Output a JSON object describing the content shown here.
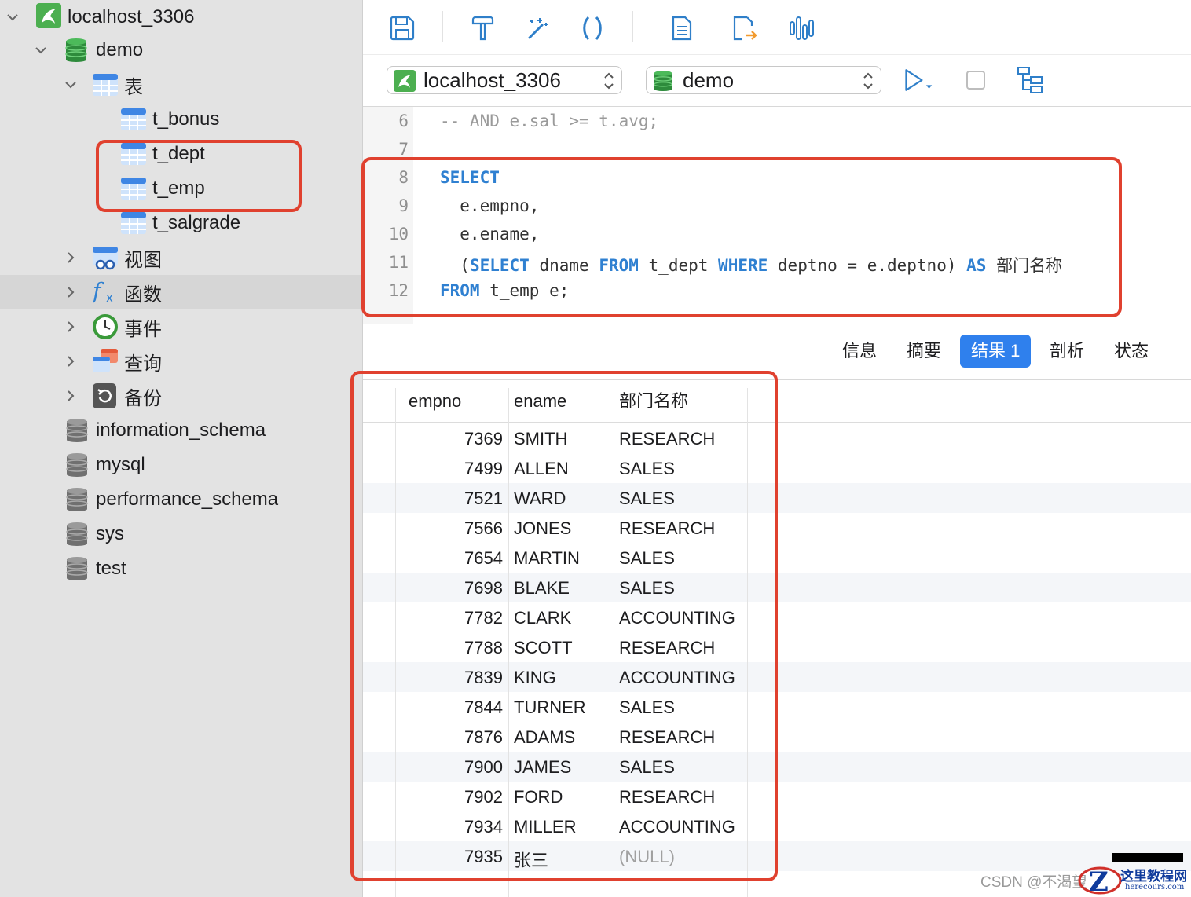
{
  "sidebar": {
    "items": [
      {
        "label": "localhost_3306",
        "icon": "mysql-connection-icon",
        "expanded": true
      },
      {
        "label": "demo",
        "icon": "database-icon",
        "expanded": true
      },
      {
        "label": "表",
        "icon": "tables-folder-icon",
        "expanded": true
      },
      {
        "label": "t_bonus",
        "icon": "table-icon"
      },
      {
        "label": "t_dept",
        "icon": "table-icon"
      },
      {
        "label": "t_emp",
        "icon": "table-icon"
      },
      {
        "label": "t_salgrade",
        "icon": "table-icon"
      },
      {
        "label": "视图",
        "icon": "views-folder-icon",
        "expanded": false
      },
      {
        "label": "函数",
        "icon": "function-icon",
        "expanded": false,
        "selected": true
      },
      {
        "label": "事件",
        "icon": "event-clock-icon",
        "expanded": false
      },
      {
        "label": "查询",
        "icon": "query-icon",
        "expanded": false
      },
      {
        "label": "备份",
        "icon": "backup-icon",
        "expanded": false
      },
      {
        "label": "information_schema",
        "icon": "database-grey-icon"
      },
      {
        "label": "mysql",
        "icon": "database-grey-icon"
      },
      {
        "label": "performance_schema",
        "icon": "database-grey-icon"
      },
      {
        "label": "sys",
        "icon": "database-grey-icon"
      },
      {
        "label": "test",
        "icon": "database-grey-icon"
      }
    ]
  },
  "toolbar": {
    "buttons": [
      "save-icon",
      "format-hammer-icon",
      "magic-wand-icon",
      "parentheses-icon",
      "document-icon",
      "export-icon",
      "explain-chart-icon"
    ]
  },
  "selectors": {
    "connection": "localhost_3306",
    "database": "demo"
  },
  "editor": {
    "lines": [
      {
        "no": "6",
        "text": "-- AND e.sal >= t.avg;"
      },
      {
        "no": "7",
        "text": ""
      },
      {
        "no": "8",
        "text": "SELECT"
      },
      {
        "no": "9",
        "text": "  e.empno,"
      },
      {
        "no": "10",
        "text": "  e.ename,"
      },
      {
        "no": "11",
        "text": "  (SELECT dname FROM t_dept WHERE deptno = e.deptno) AS 部门名称"
      },
      {
        "no": "12",
        "text": "FROM t_emp e;"
      }
    ]
  },
  "result_tabs": [
    "信息",
    "摘要",
    "结果 1",
    "剖析",
    "状态"
  ],
  "active_tab": "结果 1",
  "grid": {
    "columns": [
      "empno",
      "ename",
      "部门名称"
    ],
    "rows": [
      [
        "7369",
        "SMITH",
        "RESEARCH"
      ],
      [
        "7499",
        "ALLEN",
        "SALES"
      ],
      [
        "7521",
        "WARD",
        "SALES"
      ],
      [
        "7566",
        "JONES",
        "RESEARCH"
      ],
      [
        "7654",
        "MARTIN",
        "SALES"
      ],
      [
        "7698",
        "BLAKE",
        "SALES"
      ],
      [
        "7782",
        "CLARK",
        "ACCOUNTING"
      ],
      [
        "7788",
        "SCOTT",
        "RESEARCH"
      ],
      [
        "7839",
        "KING",
        "ACCOUNTING"
      ],
      [
        "7844",
        "TURNER",
        "SALES"
      ],
      [
        "7876",
        "ADAMS",
        "RESEARCH"
      ],
      [
        "7900",
        "JAMES",
        "SALES"
      ],
      [
        "7902",
        "FORD",
        "RESEARCH"
      ],
      [
        "7934",
        "MILLER",
        "ACCOUNTING"
      ],
      [
        "7935",
        "张三",
        "(NULL)"
      ]
    ]
  },
  "watermark": "CSDN @不渴望",
  "logo": {
    "title": "这里教程网",
    "subtitle": "herecours.com"
  },
  "colors": {
    "accent": "#2f80ed",
    "keyword": "#2f80d1",
    "annotation": "#e0412f"
  }
}
